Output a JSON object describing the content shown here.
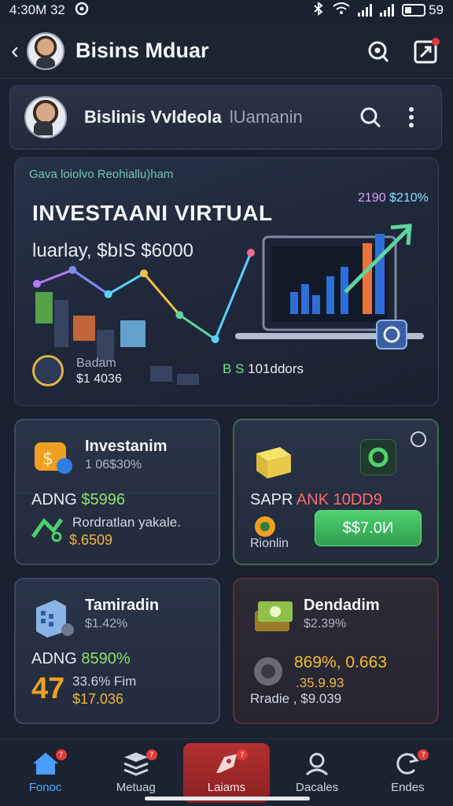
{
  "status": {
    "time": "4:30M 32",
    "battery": "59"
  },
  "appbar": {
    "title": "Bisins Mduar"
  },
  "profile": {
    "name": "Bislinis Vvldeola",
    "subtitle": "lUamanin"
  },
  "hero": {
    "caption": "Gava loiolvo Reohiallu)ham",
    "title": "INVESTAANI VIRTUAL",
    "amount": "luarlay, $bIS $6000",
    "gain_a": "2190",
    "gain_b": "$210%",
    "balance_label": "Badam",
    "balance_value": "$1 4036",
    "users_prefix": "B S",
    "users_value": "101ddors",
    "chart_data": {
      "type": "line",
      "x": [
        1,
        2,
        3,
        4,
        5,
        6,
        7
      ],
      "y": [
        62,
        70,
        56,
        68,
        44,
        30,
        80
      ]
    }
  },
  "cards": [
    {
      "title": "Investanim",
      "subtitle": "1 06$30%",
      "stat_prefix": "ADNG",
      "stat_value": "$5996",
      "line1": "Rordratlan yakale.",
      "line2": "$.6509"
    },
    {
      "title": "",
      "subtitle": "",
      "stat_prefix": "SAPR",
      "stat_value": "ANK 10DD9",
      "button": "$$7.0И",
      "line1": "Rionlin",
      "line2": ""
    },
    {
      "title": "Tamiradin",
      "subtitle": "$1.42%",
      "stat_prefix": "ADNG",
      "stat_value": "8590%",
      "line1": "33.6%   Fim",
      "line2": "$17.036"
    },
    {
      "title": "Dendadim",
      "subtitle": "$2.39%",
      "stat_prefix": "",
      "stat_value": "869%, 0.663",
      "line1": ".35.9.93",
      "line2": "Rradie , $9.039"
    }
  ],
  "nav": [
    {
      "label": "Fonoc",
      "badge": "7"
    },
    {
      "label": "Metuag",
      "badge": "7"
    },
    {
      "label": "Laiams",
      "badge": "7"
    },
    {
      "label": "Dacales",
      "badge": ""
    },
    {
      "label": "Endes",
      "badge": "7"
    }
  ]
}
